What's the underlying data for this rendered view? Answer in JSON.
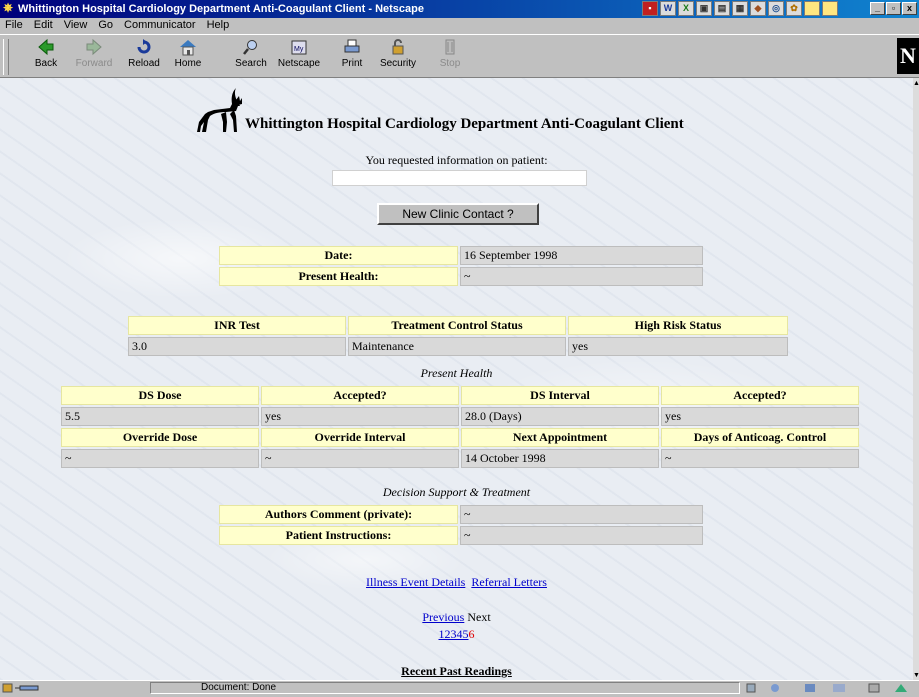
{
  "window": {
    "title": "Whittington Hospital Cardiology Department Anti-Coagulant Client - Netscape"
  },
  "menu": [
    "File",
    "Edit",
    "View",
    "Go",
    "Communicator",
    "Help"
  ],
  "toolbar": {
    "back": "Back",
    "forward": "Forward",
    "reload": "Reload",
    "home": "Home",
    "search": "Search",
    "netscape": "Netscape",
    "print": "Print",
    "security": "Security",
    "stop": "Stop"
  },
  "page": {
    "heading": "Whittington Hospital Cardiology Department Anti-Coagulant Client",
    "requested_text": "You requested information on patient:",
    "patient_value": "",
    "new_contact_button": "New Clinic Contact ?",
    "info": {
      "date_label": "Date:",
      "date_value": "16 September 1998",
      "health_label": "Present Health:",
      "health_value": "~"
    },
    "status": {
      "inr_header": "INR Test",
      "treatment_header": "Treatment Control Status",
      "risk_header": "High Risk Status",
      "inr_value": "3.0",
      "treatment_value": "Maintenance",
      "risk_value": "yes"
    },
    "present_health_caption": "Present Health",
    "dosing": {
      "ds_dose_header": "DS Dose",
      "accepted1_header": "Accepted?",
      "ds_interval_header": "DS Interval",
      "accepted2_header": "Accepted?",
      "ds_dose_value": "5.5",
      "accepted1_value": "yes",
      "ds_interval_value": "28.0 (Days)",
      "accepted2_value": "yes",
      "override_dose_header": "Override Dose",
      "override_interval_header": "Override Interval",
      "next_appt_header": "Next Appointment",
      "days_control_header": "Days of Anticoag. Control",
      "override_dose_value": "~",
      "override_interval_value": "~",
      "next_appt_value": "14 October 1998",
      "days_control_value": "~"
    },
    "decision_caption": "Decision Support & Treatment",
    "comments": {
      "authors_label": "Authors Comment (private):",
      "authors_value": "~",
      "instructions_label": "Patient Instructions:",
      "instructions_value": "~"
    },
    "links": {
      "illness": "Illness Event Details",
      "referral": "Referral Letters"
    },
    "pager": {
      "previous": "Previous",
      "next": "Next",
      "p1": "1",
      "p2": "2",
      "p3": "3",
      "p4": "4",
      "p5": "5",
      "p6": "6"
    },
    "recent_readings": "Recent Past Readings"
  },
  "status": {
    "text": "Document: Done"
  }
}
